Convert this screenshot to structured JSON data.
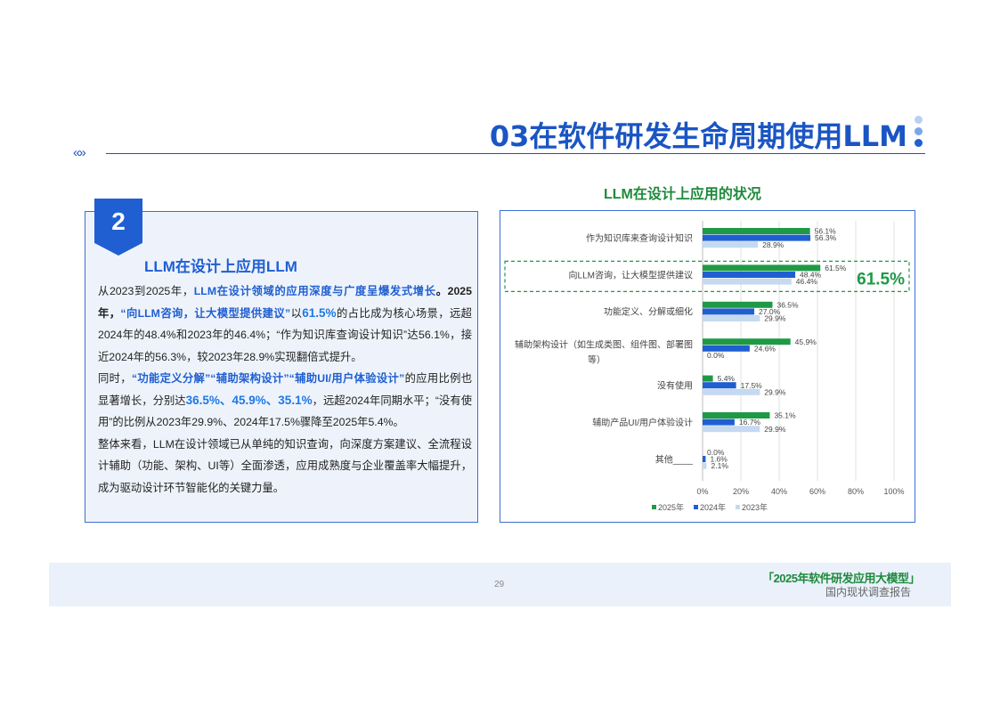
{
  "header": {
    "title": "03在软件研发生命周期使用LLM",
    "chevrons": "«»",
    "dot_colors": [
      "#b9d0f2",
      "#7aa7e8",
      "#1f5fd1"
    ]
  },
  "left_panel": {
    "badge_number": "2",
    "heading": "LLM在设计上应用LLM",
    "p1": {
      "a": "从2023到2025年，",
      "b": "LLM在设计领域的应用深度与广度呈爆发式增长",
      "c": "。2025年，",
      "d": "“向LLM咨询，让大模型提供建议”",
      "e": "以",
      "f": "61.5%",
      "g": "的占比成为核心场景，远超2024年的48.4%和2023年的46.4%；“作为知识库查询设计知识”达56.1%，接近2024年的56.3%，较2023年28.9%实现翻倍式提升。"
    },
    "p2": {
      "a": "同时，",
      "b": "“功能定义分解”“辅助架构设计”“辅助UI/用户体验设计”",
      "c": "的应用比例也显著增长，分别达",
      "d": "36.5%、45.9%、35.1%",
      "e": "，远超2024年同期水平；“没有使用”的比例从2023年29.9%、2024年17.5%骤降至2025年5.4%。"
    },
    "p3": "整体来看，LLM在设计领域已从单纯的知识查询，向深度方案建议、全流程设计辅助（功能、架构、UI等）全面渗透，应用成熟度与企业覆盖率大幅提升，成为驱动设计环节智能化的关键力量。"
  },
  "chart_data": {
    "type": "bar",
    "orientation": "horizontal",
    "title": "LLM在设计上应用的状况",
    "categories": [
      [
        "作为知识库来查询设计知识"
      ],
      [
        "向LLM咨询，让大模型提供建议"
      ],
      [
        "功能定义、分解或细化"
      ],
      [
        "辅助架构设计（如生成类图、组件图、部署图",
        "等）"
      ],
      [
        "没有使用"
      ],
      [
        "辅助产品UI/用户体验设计"
      ],
      [
        "其他____"
      ]
    ],
    "series": [
      {
        "name": "2025年",
        "color": "#1e9a45",
        "values": [
          56.1,
          61.5,
          36.5,
          45.9,
          5.4,
          35.1,
          0.0
        ]
      },
      {
        "name": "2024年",
        "color": "#1f5fd1",
        "values": [
          56.3,
          48.4,
          27.0,
          24.6,
          17.5,
          16.7,
          1.6
        ]
      },
      {
        "name": "2023年",
        "color": "#c5d9f1",
        "values": [
          28.9,
          46.4,
          29.9,
          0.0,
          29.9,
          29.9,
          2.1
        ]
      }
    ],
    "xlim": [
      0,
      100
    ],
    "xticks": [
      "0%",
      "20%",
      "40%",
      "60%",
      "80%",
      "100%"
    ],
    "highlight": {
      "category_index": 1,
      "label": "61.5%",
      "color": "#1e9a45"
    },
    "legend_position": "bottom",
    "grid": true
  },
  "footer": {
    "page_number": "29",
    "brand": "「2025年软件研发应用大模型」",
    "subtitle": "国内现状调查报告"
  }
}
